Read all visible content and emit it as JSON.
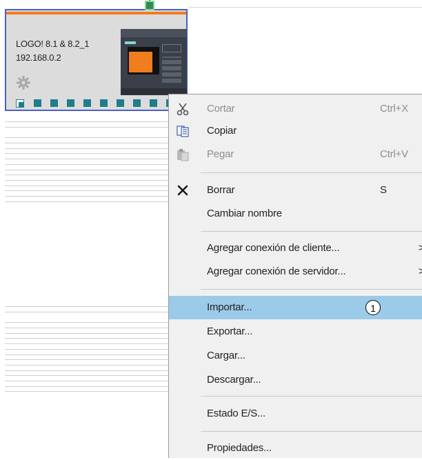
{
  "device": {
    "name": "LOGO! 8.1 & 8.2_1",
    "ip": "192.168.0.2",
    "led_count": 9
  },
  "colors": {
    "selection_border": "#4a5fc7",
    "accent_orange": "#f07d1e",
    "led_teal": "#1e7e8a",
    "menu_highlight": "#9ccbea"
  },
  "context_menu": {
    "items": [
      {
        "label": "Cortar",
        "shortcut": "Ctrl+X",
        "icon": "scissors-icon",
        "disabled": true
      },
      {
        "label": "Copiar",
        "shortcut": "",
        "icon": "copy-icon",
        "disabled": false
      },
      {
        "label": "Pegar",
        "shortcut": "Ctrl+V",
        "icon": "paste-icon",
        "disabled": true
      },
      {
        "label": "Borrar",
        "shortcut": "S",
        "icon": "delete-x-icon",
        "disabled": false
      },
      {
        "label": "Cambiar nombre",
        "shortcut": "",
        "icon": "",
        "disabled": false
      },
      {
        "label": "Agregar conexión de cliente...",
        "shortcut": "",
        "submenu": ">",
        "disabled": false
      },
      {
        "label": "Agregar conexión de servidor...",
        "shortcut": "",
        "submenu": ">",
        "disabled": false
      },
      {
        "label": "Importar...",
        "shortcut": "",
        "callout": "1",
        "active": true
      },
      {
        "label": "Exportar...",
        "shortcut": ""
      },
      {
        "label": "Cargar...",
        "shortcut": ""
      },
      {
        "label": "Descargar...",
        "shortcut": ""
      },
      {
        "label": "Estado E/S...",
        "shortcut": ""
      },
      {
        "label": "Propiedades...",
        "shortcut": ""
      }
    ]
  }
}
